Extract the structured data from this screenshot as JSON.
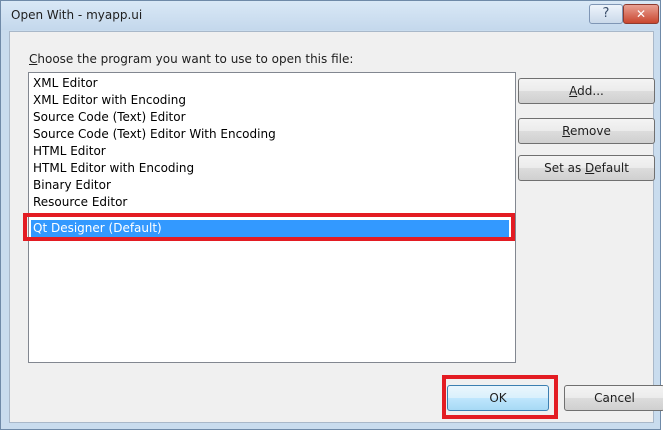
{
  "window": {
    "title": "Open With - myapp.ui",
    "help_label": "?",
    "close_label": "✕"
  },
  "prompt": {
    "first_letter": "C",
    "rest": "hoose the program you want to use to open this file:"
  },
  "programs": [
    {
      "label": "XML Editor",
      "selected": false
    },
    {
      "label": "XML Editor with Encoding",
      "selected": false
    },
    {
      "label": "Source Code (Text) Editor",
      "selected": false
    },
    {
      "label": "Source Code (Text) Editor With Encoding",
      "selected": false
    },
    {
      "label": "HTML Editor",
      "selected": false
    },
    {
      "label": "HTML Editor with Encoding",
      "selected": false
    },
    {
      "label": "Binary Editor",
      "selected": false
    },
    {
      "label": "Resource Editor",
      "selected": false
    },
    {
      "label": "Qt Designer (Default)",
      "selected": true
    }
  ],
  "buttons": {
    "add": {
      "pre": "",
      "key": "A",
      "post": "dd..."
    },
    "remove": {
      "pre": "",
      "key": "R",
      "post": "emove"
    },
    "set_default": {
      "pre": "Set as ",
      "key": "D",
      "post": "efault"
    },
    "ok": "OK",
    "cancel": "Cancel"
  },
  "colors": {
    "selection": "#3399ff",
    "annotation_highlight": "#e31c23"
  }
}
